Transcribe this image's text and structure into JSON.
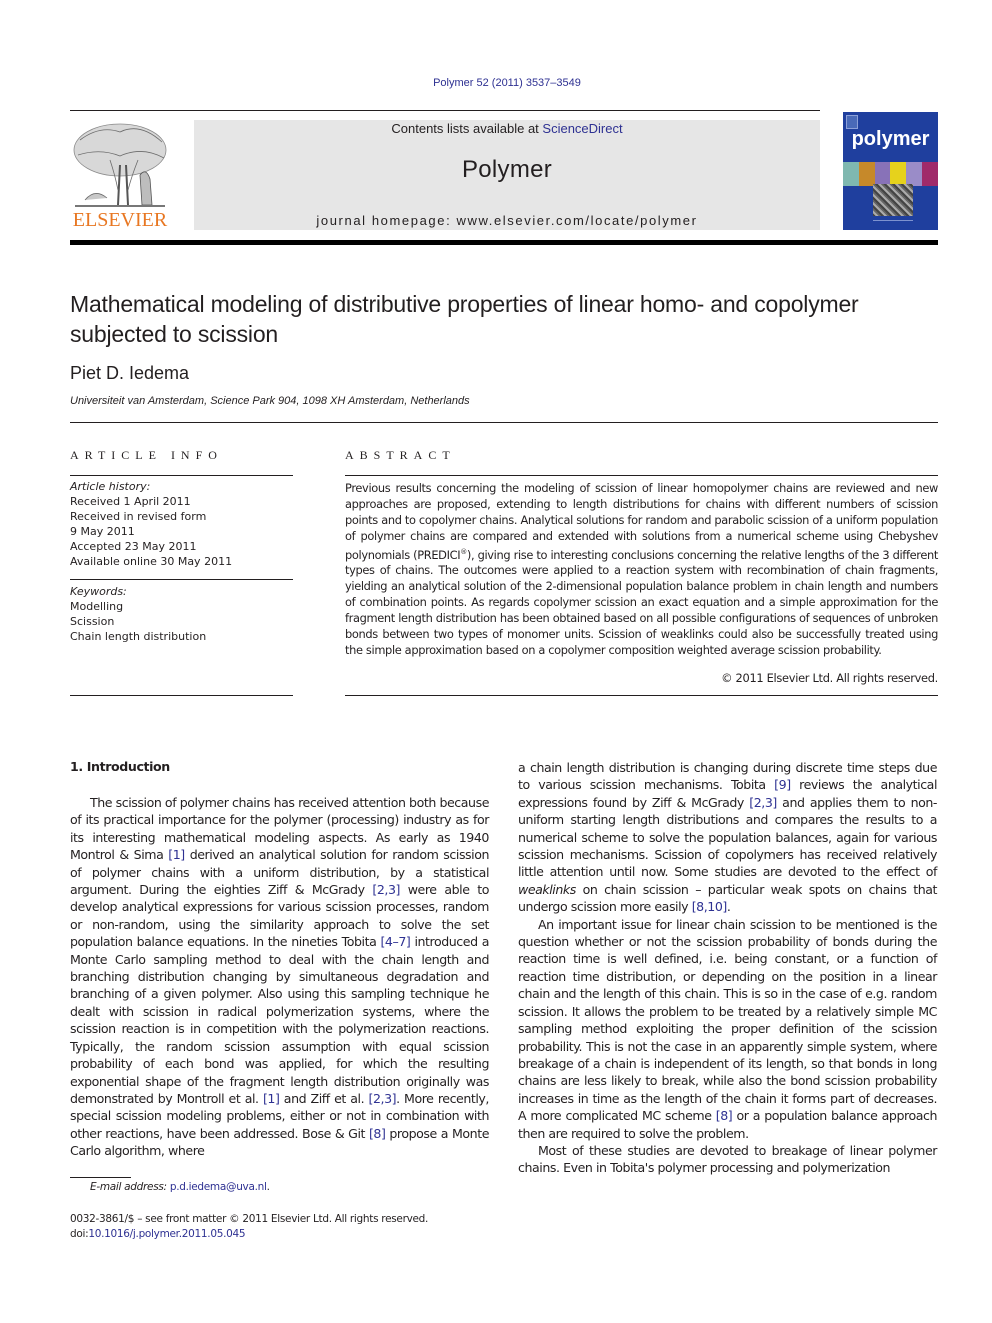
{
  "citation": "Polymer 52 (2011) 3537–3549",
  "header": {
    "publisher_logo_text": "ELSEVIER",
    "contents_prefix": "Contents lists available at ",
    "contents_link": "ScienceDirect",
    "journal_name": "Polymer",
    "homepage": "journal homepage: www.elsevier.com/locate/polymer",
    "cover_title": "polymer"
  },
  "article": {
    "title": "Mathematical modeling of distributive properties of linear homo- and copolymer subjected to scission",
    "author": "Piet D. Iedema",
    "affiliation": "Universiteit van Amsterdam, Science Park 904, 1098 XH Amsterdam, Netherlands"
  },
  "article_info": {
    "heading": "ARTICLE INFO",
    "history_label": "Article history:",
    "history": [
      "Received 1 April 2011",
      "Received in revised form",
      "9 May 2011",
      "Accepted 23 May 2011",
      "Available online 30 May 2011"
    ],
    "keywords_label": "Keywords:",
    "keywords": [
      "Modelling",
      "Scission",
      "Chain length distribution"
    ]
  },
  "abstract": {
    "heading": "ABSTRACT",
    "text_part1": "Previous results concerning the modeling of scission of linear homopolymer chains are reviewed and new approaches are proposed, extending to length distributions for chains with different numbers of scission points and to copolymer chains. Analytical solutions for random and parabolic scission of a uniform population of polymer chains are compared and extended with solutions from a numerical scheme using Chebyshev polynomials (PREDICI",
    "registered_mark": "®",
    "text_part2": "), giving rise to interesting conclusions concerning the relative lengths of the 3 different types of chains. The outcomes were applied to a reaction system with recombination of chain fragments, yielding an analytical solution of the 2-dimensional population balance problem in chain length and numbers of combination points. As regards copolymer scission an exact equation and a simple approximation for the fragment length distribution has been obtained based on all possible configurations of sequences of unbroken bonds between two types of monomer units. Scission of weaklinks could also be successfully treated using the simple approximation based on a copolymer composition weighted average scission probability.",
    "copyright": "© 2011 Elsevier Ltd. All rights reserved."
  },
  "body": {
    "section_heading": "1.  Introduction",
    "left": {
      "p1": [
        "The scission of polymer chains has received attention both because of its practical importance for the polymer (processing) industry as for its interesting mathematical modeling aspects. As early as 1940 Montrol & Sima ",
        "[1]",
        " derived an analytical solution for random scission of polymer chains with a uniform distribution, by a statistical argument. During the eighties Ziff & McGrady ",
        "[2,3]",
        " were able to develop analytical expressions for various scission processes, random or non-random, using the similarity approach to solve the set population balance equations. In the nineties Tobita ",
        "[4–7]",
        " introduced a Monte Carlo sampling method to deal with the chain length and branching distribution changing by simultaneous degradation and branching of a given polymer. Also using this sampling technique he dealt with scission in radical polymerization systems, where the scission reaction is in competition with the polymerization reactions. Typically, the random scission assump­tion with equal scission probability of each bond was applied, for which the resulting exponential shape of the fragment length distribution originally was demonstrated by Montroll et al. ",
        "[1]",
        " and Ziff et al. ",
        "[2,3]",
        ". More recently, special scission modeling problems, either or not in combination with other reactions, have been addressed. Bose & Git ",
        "[8]",
        " propose a Monte Carlo algorithm, where"
      ]
    },
    "right": {
      "p1": [
        "a chain length distribution is changing during discrete time steps due to various scission mechanisms. Tobita ",
        "[9]",
        " reviews the analytical expressions found by Ziff & McGrady ",
        "[2,3]",
        " and applies them to non-uniform starting length distributions and compares the results to a numerical scheme to solve the population balances, again for various scission mechanisms. Scission of copolymers has received relatively little attention until now. Some studies are devoted to the effect of ",
        "weaklinks",
        " on chain scission – particular weak spots on chains that undergo scission more easily ",
        "[8,10]",
        "."
      ],
      "p2": [
        "An important issue for linear chain scission to be mentioned is the question whether or not the scission probability of bonds during the reaction time is well defined, i.e. being constant, or a function of reaction time distribution, or depending on the position in a linear chain and the length of this chain. This is so in the case of e.g. random scission. It allows the problem to be treated by a relatively simple MC sampling method exploiting the proper definition of the scission probability. This is not the case in an apparently simple system, where breakage of a chain is indepen­dent of its length, so that bonds in long chains are less likely to break, while also the bond scission probability increases in time as the length of the chain it forms part of decreases. A more compli­cated MC scheme ",
        "[8]",
        " or a population balance approach then are required to solve the problem."
      ],
      "p3": "Most of these studies are devoted to breakage of linear polymer chains. Even in Tobita's polymer processing and polymerization"
    }
  },
  "footnotes": {
    "email_label": "E-mail address: ",
    "email": "p.d.iedema@uva.nl",
    "email_suffix": ".",
    "issn_line": "0032-3861/$ – see front matter © 2011 Elsevier Ltd. All rights reserved.",
    "doi_label": "doi:",
    "doi": "10.1016/j.polymer.2011.05.045"
  },
  "colors": {
    "link": "#2e3192",
    "elsevier_orange": "#e87722",
    "band_grey": "#e6e6e6",
    "cover_blue": "#1f3f9e"
  }
}
